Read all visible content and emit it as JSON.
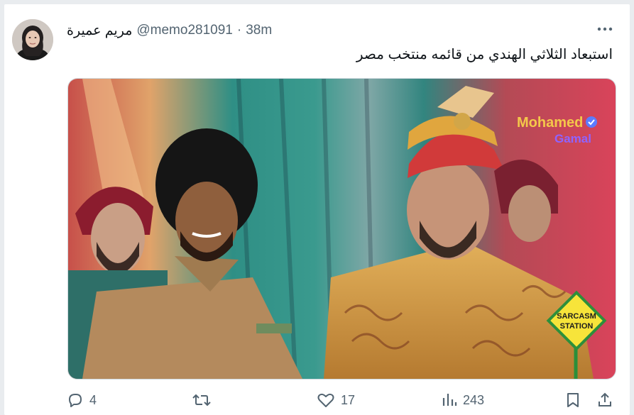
{
  "tweet": {
    "author_name": "مريم عميرة",
    "handle": "@memo281091",
    "separator": "·",
    "time": "38m",
    "text": "استبعاد الثلاثي الهندي من قائمه منتخب مصر"
  },
  "media": {
    "watermark_top": "Mohamed",
    "watermark_bottom": "Gamal",
    "sign_line1": "SARCASM",
    "sign_line2": "STATION"
  },
  "actions": {
    "replies": "4",
    "reposts": "",
    "likes": "17",
    "views": "243"
  },
  "icons": {
    "more": "more-horizontal-icon",
    "reply": "reply-icon",
    "repost": "repost-icon",
    "like": "heart-icon",
    "views": "views-chart-icon",
    "bookmark": "bookmark-icon",
    "share": "share-icon"
  },
  "colors": {
    "text": "#0f1419",
    "secondary": "#536471",
    "accent_gold": "#d6a13b",
    "sign_yellow": "#f7e43a"
  }
}
